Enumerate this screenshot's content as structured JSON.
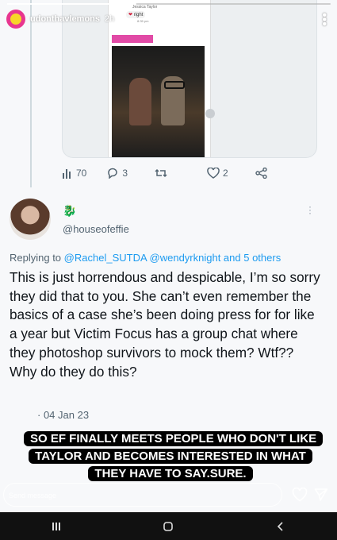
{
  "story": {
    "username": "udonthavlemons",
    "time": "2h",
    "reply_placeholder": "Send message",
    "caption": "SO EF FINALLY MEETS PEOPLE WHO DON'T LIKE TAYLOR AND BECOMES INTERESTED IN WHAT THEY HAVE TO SAY.SURE."
  },
  "embedded": {
    "phone_contact": "Jessica Taylor",
    "phone_message": "right",
    "phone_timestamp": "8:35 pm"
  },
  "tweet_actions": {
    "views": "70",
    "replies": "3",
    "retweets": "",
    "likes": "2"
  },
  "reply_tweet": {
    "name_emoji": "🐉",
    "handle": "@houseofeffie",
    "replying_prefix": "Replying to",
    "replying_mentions": "@Rachel_SUTDA @wendyrknight and 5 others",
    "text": "This is just horrendous and despicable, I’m so sorry they did that to you. She can’t even remember the basics of a case she’s been doing press for for like a year but Victim Focus has a group chat where they photoshop survivors to mock them? Wtf?? Why do they do this?",
    "date": "04 Jan 23"
  },
  "colors": {
    "link_blue": "#1d9bf0",
    "muted_gray": "#536471",
    "accent_pink": "#e14aa6"
  },
  "icons": {
    "views": "bar-chart-icon",
    "reply": "comment-icon",
    "retweet": "retweet-icon",
    "like": "heart-icon",
    "share": "share-icon"
  }
}
